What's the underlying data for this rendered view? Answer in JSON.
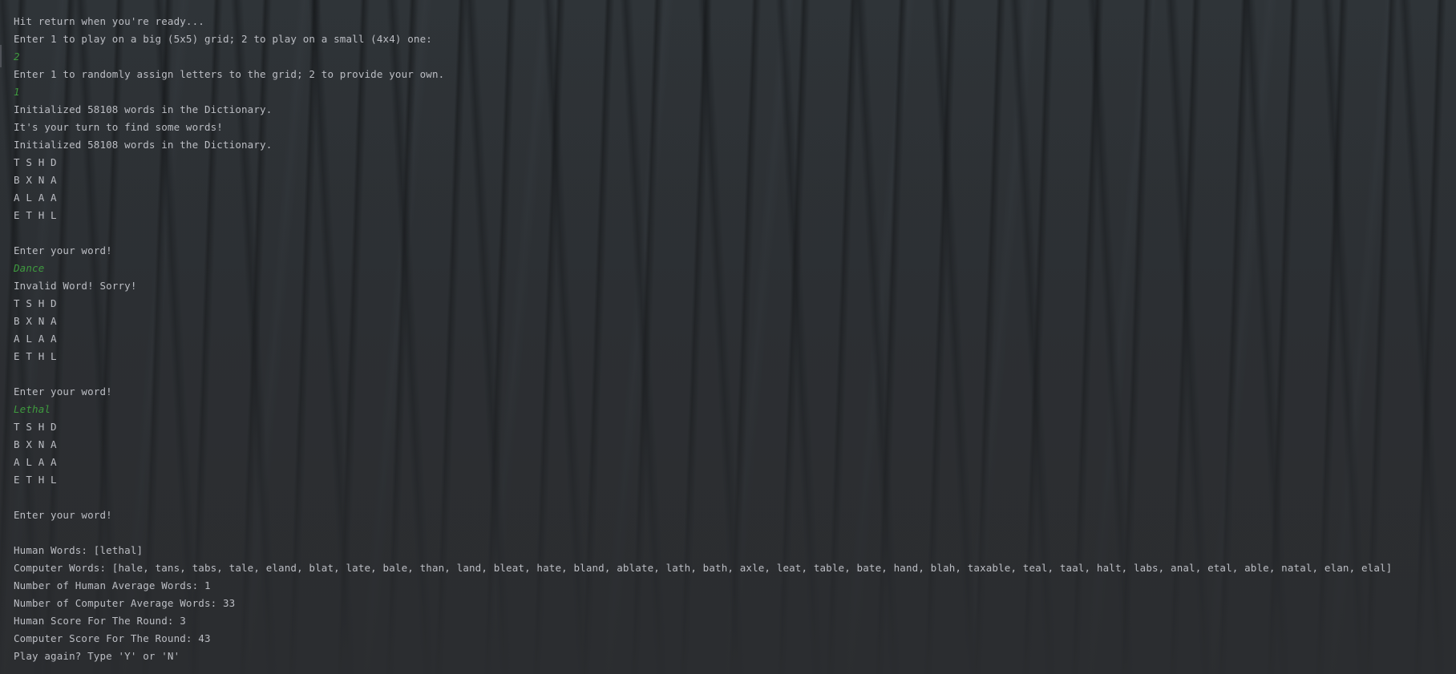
{
  "console": {
    "lines": [
      {
        "text": "Hit return when you're ready...",
        "kind": "out"
      },
      {
        "text": "Enter 1 to play on a big (5x5) grid; 2 to play on a small (4x4) one:",
        "kind": "out"
      },
      {
        "text": "2",
        "kind": "input"
      },
      {
        "text": "Enter 1 to randomly assign letters to the grid; 2 to provide your own.",
        "kind": "out"
      },
      {
        "text": "1",
        "kind": "input"
      },
      {
        "text": "Initialized 58108 words in the Dictionary.",
        "kind": "out"
      },
      {
        "text": "It's your turn to find some words!",
        "kind": "out"
      },
      {
        "text": "Initialized 58108 words in the Dictionary.",
        "kind": "out"
      },
      {
        "text": "T S H D",
        "kind": "out"
      },
      {
        "text": "B X N A",
        "kind": "out"
      },
      {
        "text": "A L A A",
        "kind": "out"
      },
      {
        "text": "E T H L",
        "kind": "out"
      },
      {
        "text": "",
        "kind": "out"
      },
      {
        "text": "Enter your word!",
        "kind": "out"
      },
      {
        "text": "Dance",
        "kind": "input"
      },
      {
        "text": "Invalid Word! Sorry!",
        "kind": "out"
      },
      {
        "text": "T S H D",
        "kind": "out"
      },
      {
        "text": "B X N A",
        "kind": "out"
      },
      {
        "text": "A L A A",
        "kind": "out"
      },
      {
        "text": "E T H L",
        "kind": "out"
      },
      {
        "text": "",
        "kind": "out"
      },
      {
        "text": "Enter your word!",
        "kind": "out"
      },
      {
        "text": "Lethal",
        "kind": "input"
      },
      {
        "text": "T S H D",
        "kind": "out"
      },
      {
        "text": "B X N A",
        "kind": "out"
      },
      {
        "text": "A L A A",
        "kind": "out"
      },
      {
        "text": "E T H L",
        "kind": "out"
      },
      {
        "text": "",
        "kind": "out"
      },
      {
        "text": "Enter your word!",
        "kind": "out"
      },
      {
        "text": "",
        "kind": "out"
      },
      {
        "text": "Human Words: [lethal]",
        "kind": "out"
      },
      {
        "text": "Computer Words: [hale, tans, tabs, tale, eland, blat, late, bale, than, land, bleat, hate, bland, ablate, lath, bath, axle, leat, table, bate, hand, blah, taxable, teal, taal, halt, labs, anal, etal, able, natal, elan, elal]",
        "kind": "out"
      },
      {
        "text": "Number of Human Average Words: 1",
        "kind": "out"
      },
      {
        "text": "Number of Computer Average Words: 33",
        "kind": "out"
      },
      {
        "text": "Human Score For The Round: 3",
        "kind": "out"
      },
      {
        "text": "Computer Score For The Round: 43",
        "kind": "out"
      },
      {
        "text": "Play again? Type 'Y' or 'N'",
        "kind": "out"
      }
    ]
  }
}
